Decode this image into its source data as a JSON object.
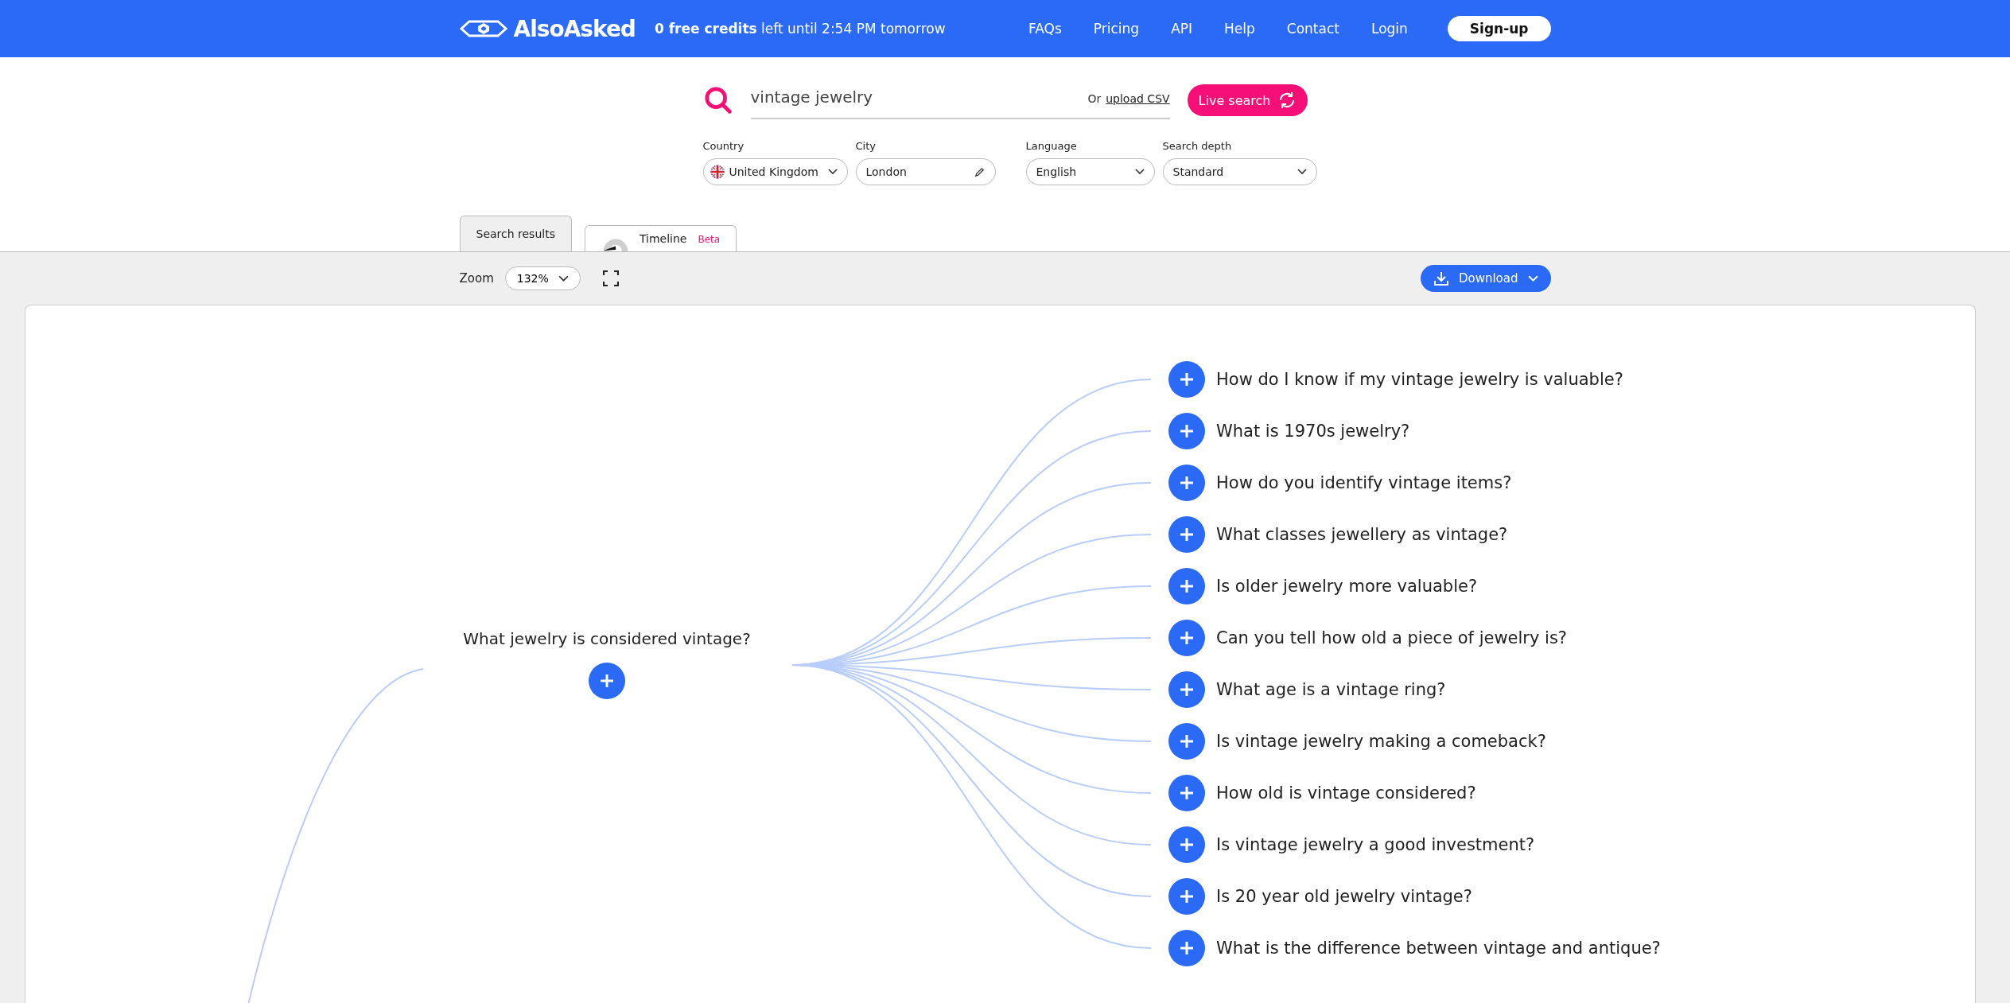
{
  "header": {
    "logo": "AlsoAsked",
    "credits": "**0 free credits** left until 2:54 PM tomorrow",
    "nav": [
      "FAQs",
      "Pricing",
      "API",
      "Help",
      "Contact",
      "Login"
    ],
    "signup": "Sign-up"
  },
  "search": {
    "value": "vintage jewelry",
    "or": "Or",
    "upload": "upload CSV",
    "button": "Live search"
  },
  "filters": [
    {
      "label": "Country",
      "value": "United Kingdom",
      "kind": "country"
    },
    {
      "label": "City",
      "value": "London",
      "kind": "text"
    },
    {
      "label": "Language",
      "value": "English",
      "kind": "select"
    },
    {
      "label": "Search depth",
      "value": "Standard",
      "kind": "select"
    }
  ],
  "tabs": [
    {
      "label": "Search results",
      "selected": true
    },
    {
      "label": "Timeline",
      "badge": "Beta",
      "selected": false
    }
  ],
  "toolbar": {
    "zoom_label": "Zoom",
    "zoom": "132%",
    "download": "Download"
  },
  "tree": {
    "question": "What jewelry is considered vintage?",
    "children": [
      {
        "question": "How do I know if my vintage jewelry is valuable?"
      },
      {
        "question": "What is 1970s jewelry?"
      },
      {
        "question": "How do you identify vintage items?"
      },
      {
        "question": "What classes jewellery as vintage?"
      },
      {
        "question": "Is older jewelry more valuable?"
      },
      {
        "question": "Can you tell how old a piece of jewelry is?"
      },
      {
        "question": "What age is a vintage ring?"
      },
      {
        "question": "Is vintage jewelry making a comeback?"
      },
      {
        "question": "How old is vintage considered?"
      },
      {
        "question": "Is vintage jewelry a good investment?"
      },
      {
        "question": "Is 20 year old jewelry vintage?"
      },
      {
        "question": "What is the difference between vintage and antique?"
      }
    ]
  }
}
